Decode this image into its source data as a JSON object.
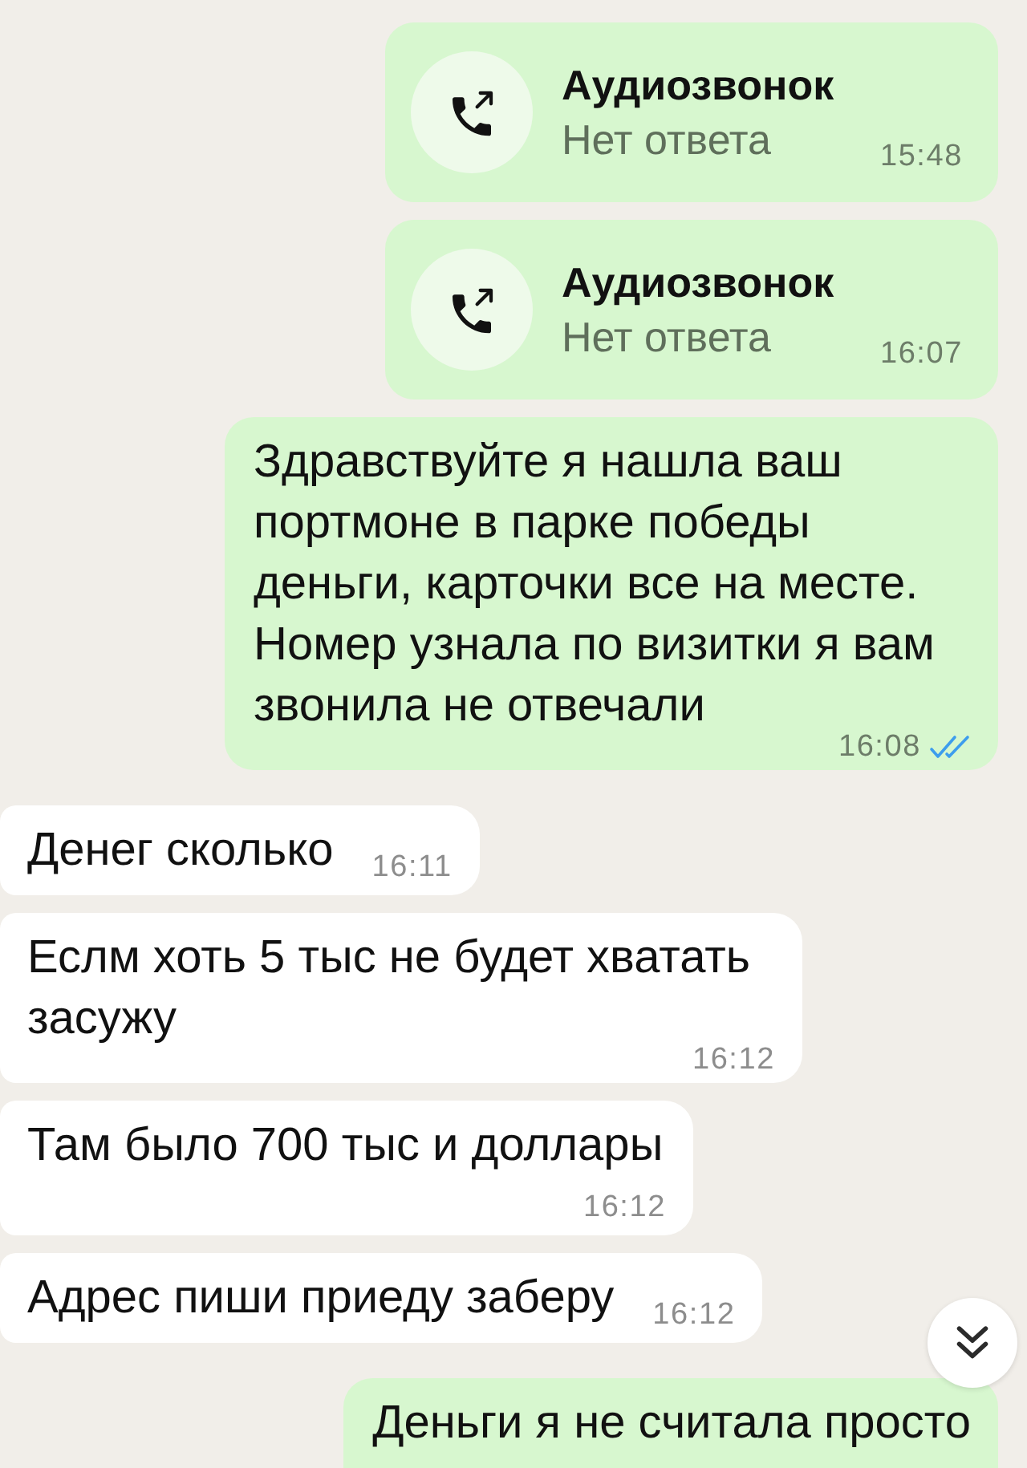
{
  "messages": [
    {
      "kind": "call",
      "outgoing": true,
      "title": "Аудиозвонок",
      "status": "Нет ответа",
      "time": "15:48"
    },
    {
      "kind": "call",
      "outgoing": true,
      "title": "Аудиозвонок",
      "status": "Нет ответа",
      "time": "16:07"
    },
    {
      "kind": "text",
      "outgoing": true,
      "text": "Здравствуйте я нашла ваш портмоне в парке победы деньги, карточки все на месте. Номер узнала по визитки я вам звонила не отвечали",
      "time": "16:08",
      "read": true
    },
    {
      "kind": "text",
      "outgoing": false,
      "text": "Денег сколько",
      "time": "16:11"
    },
    {
      "kind": "text",
      "outgoing": false,
      "text": "Еслм хоть 5 тыс не будет хватать засужу",
      "time": "16:12"
    },
    {
      "kind": "text",
      "outgoing": false,
      "text": "Там было 700 тыс и доллары",
      "time": "16:12"
    },
    {
      "kind": "text",
      "outgoing": false,
      "text": "Адрес пиши приеду заберу",
      "time": "16:12"
    },
    {
      "kind": "text",
      "outgoing": true,
      "text": "Деньги я не считала просто"
    }
  ]
}
